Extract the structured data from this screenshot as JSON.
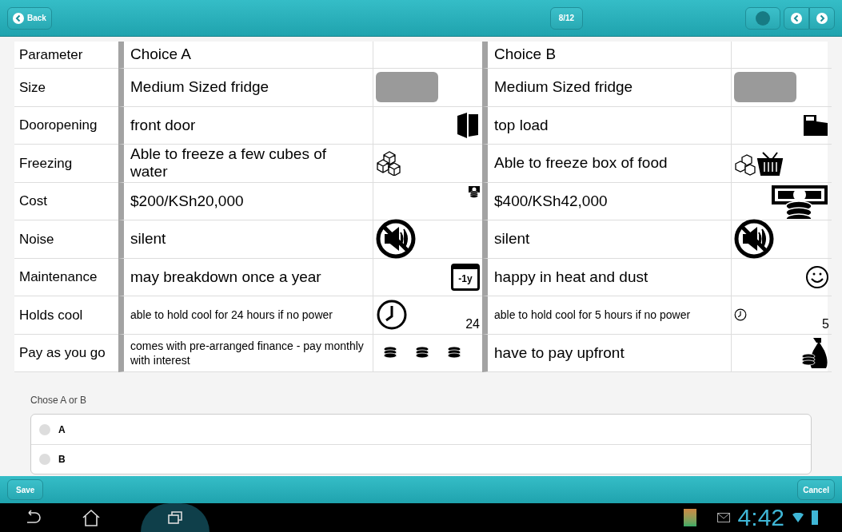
{
  "header": {
    "back": "Back",
    "page": "8/12"
  },
  "table": {
    "columns": [
      "Parameter",
      "Choice A",
      "Choice B"
    ],
    "rows": [
      {
        "parameter": "Size",
        "a": "Medium Sized fridge",
        "a_icon": {
          "kind": "photo"
        },
        "b": "Medium Sized fridge",
        "b_icon": {
          "kind": "photo"
        }
      },
      {
        "parameter": "Dooropening",
        "a": "front door",
        "a_icon": {
          "kind": "door"
        },
        "b": "top load",
        "b_icon": {
          "kind": "chest"
        }
      },
      {
        "parameter": "Freezing",
        "a": "Able to freeze a few cubes of water",
        "a_icon": {
          "kind": "ice"
        },
        "b": "Able to freeze box of food",
        "b_icon": {
          "kind": "ice-basket"
        }
      },
      {
        "parameter": "Cost",
        "a": "$200/KSh20,000",
        "a_icon": {
          "kind": "cash-small"
        },
        "b": "$400/KSh42,000",
        "b_icon": {
          "kind": "cash-large"
        }
      },
      {
        "parameter": "Noise",
        "a": "silent",
        "a_icon": {
          "kind": "mute"
        },
        "b": "silent",
        "b_icon": {
          "kind": "mute"
        }
      },
      {
        "parameter": "Maintenance",
        "a": "may breakdown once a year",
        "a_icon": {
          "kind": "calendar",
          "text": "-1y"
        },
        "b": "happy in heat and dust",
        "b_icon": {
          "kind": "smile"
        }
      },
      {
        "parameter": "Holds cool",
        "a": "able to hold cool for 24 hours if no power",
        "a_icon": {
          "kind": "clock-large",
          "text": "24"
        },
        "b": "able to hold cool for 5 hours if no power",
        "b_icon": {
          "kind": "clock-small",
          "text": "5"
        }
      },
      {
        "parameter": "Pay as you go",
        "a": "comes with pre-arranged finance - pay monthly with interest",
        "a_icon": {
          "kind": "coins"
        },
        "b": "have to pay upfront",
        "b_icon": {
          "kind": "money-bag"
        }
      }
    ]
  },
  "question": {
    "label": "Chose A or B",
    "options": [
      {
        "label": "A",
        "selected": false
      },
      {
        "label": "B",
        "selected": false
      }
    ]
  },
  "footer": {
    "save": "Save",
    "cancel": "Cancel"
  },
  "status_bar": {
    "time": "4:42"
  }
}
